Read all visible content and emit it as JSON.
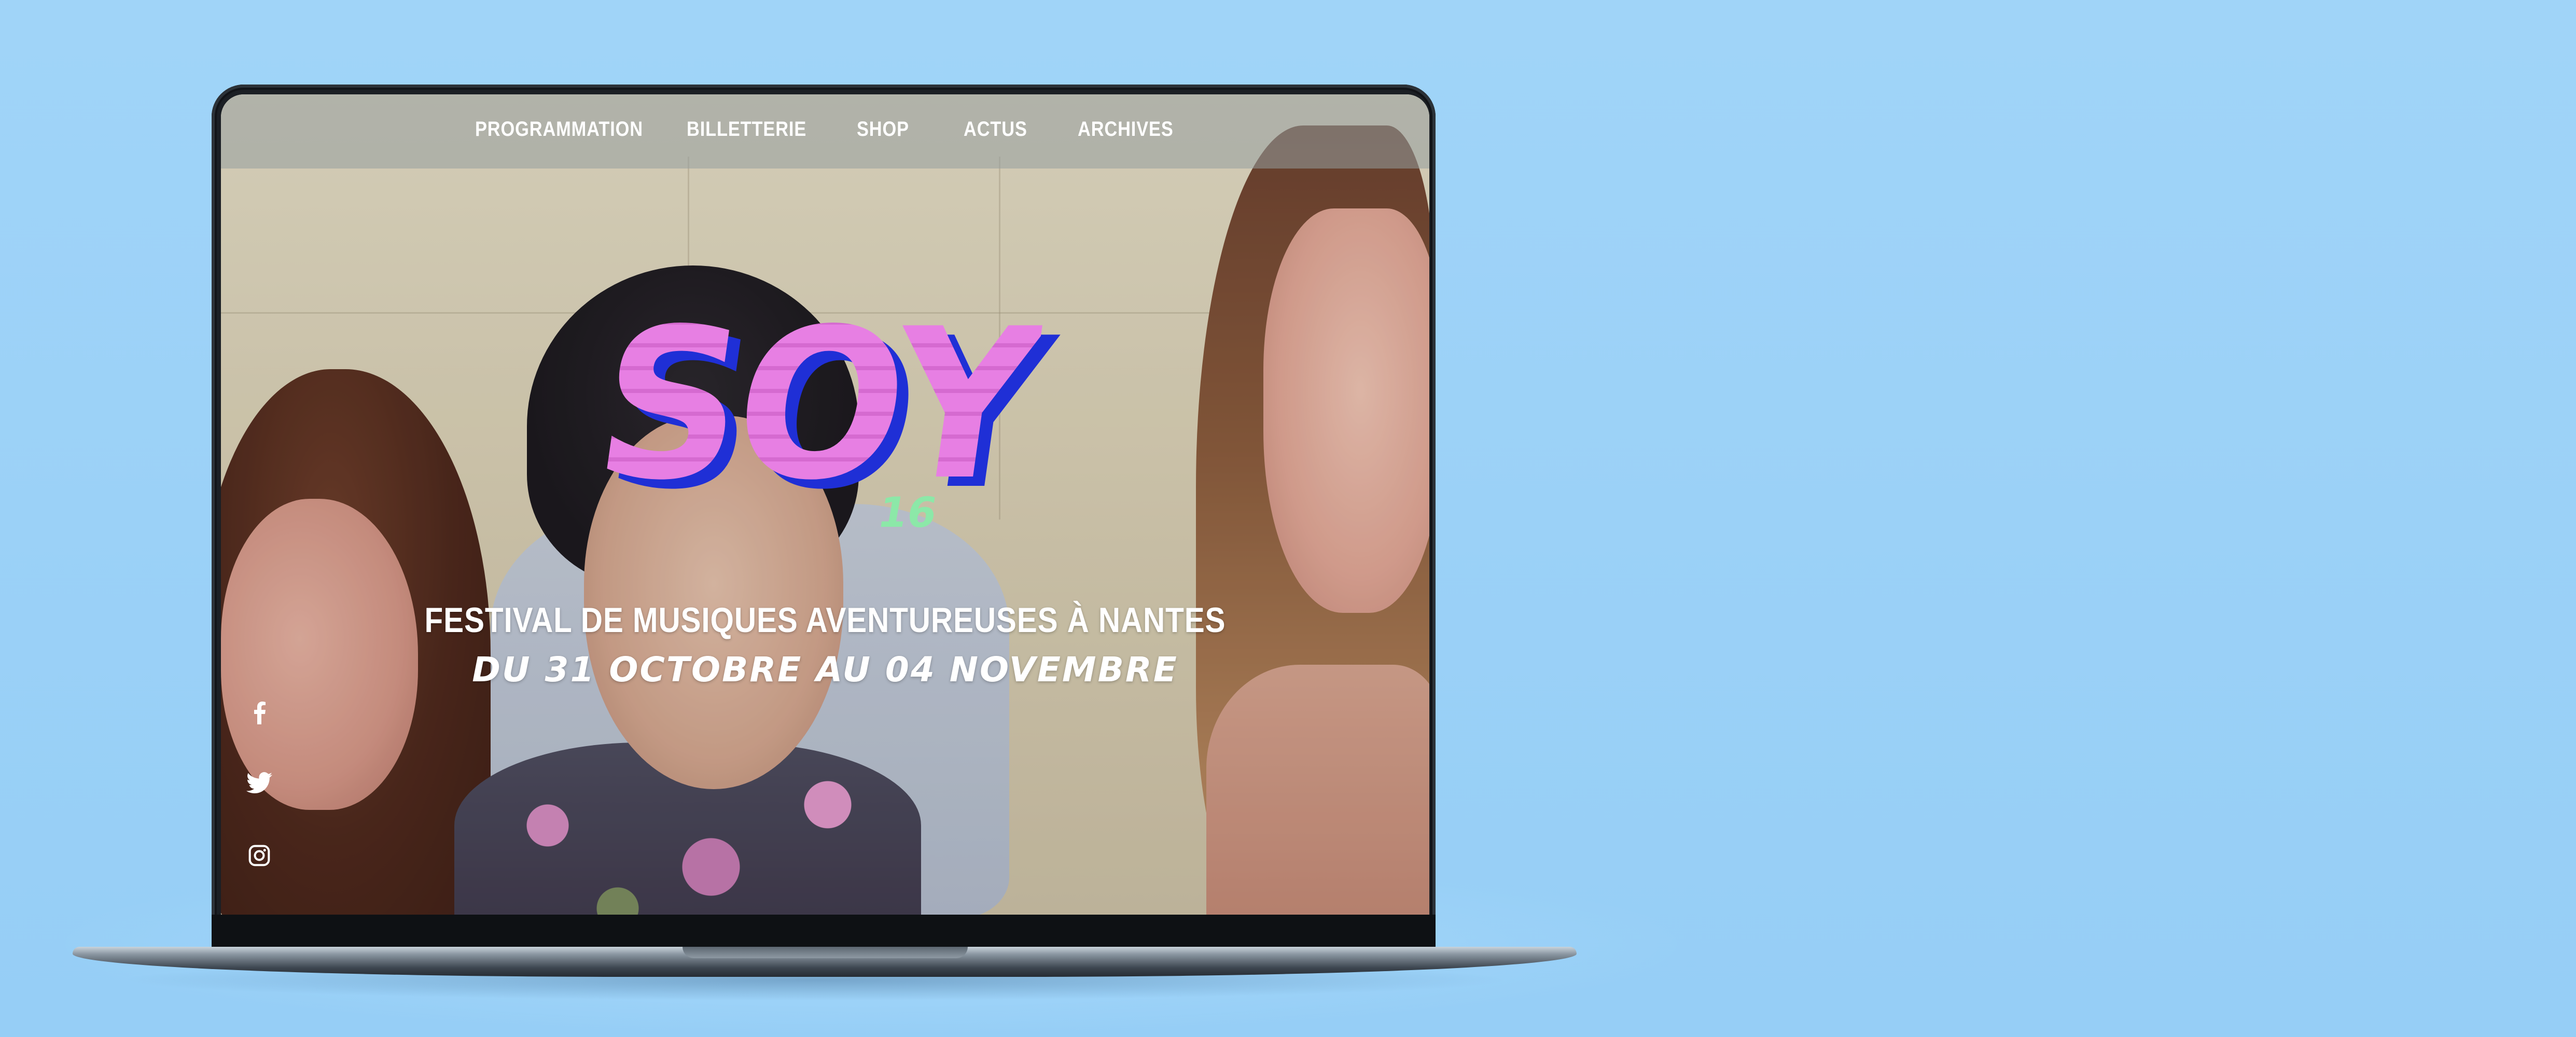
{
  "nav": {
    "items": [
      {
        "label": "PROGRAMMATION"
      },
      {
        "label": "BILLETTERIE"
      },
      {
        "label": "SHOP"
      },
      {
        "label": "ACTUS"
      },
      {
        "label": "ARCHIVES"
      }
    ]
  },
  "hero": {
    "logo_text": "SOY",
    "logo_edition": "16",
    "tagline": "FESTIVAL DE MUSIQUES AVENTUREUSES À NANTES",
    "dates": "DU 31 OCTOBRE AU 04 NOVEMBRE"
  },
  "social": {
    "icons": [
      "facebook-icon",
      "twitter-icon",
      "instagram-icon"
    ]
  },
  "colors": {
    "background": "#9dd3f7",
    "logo_pink": "#e77fe3",
    "logo_blue": "#1f2fd6",
    "edition_green": "#8ce8a8"
  }
}
